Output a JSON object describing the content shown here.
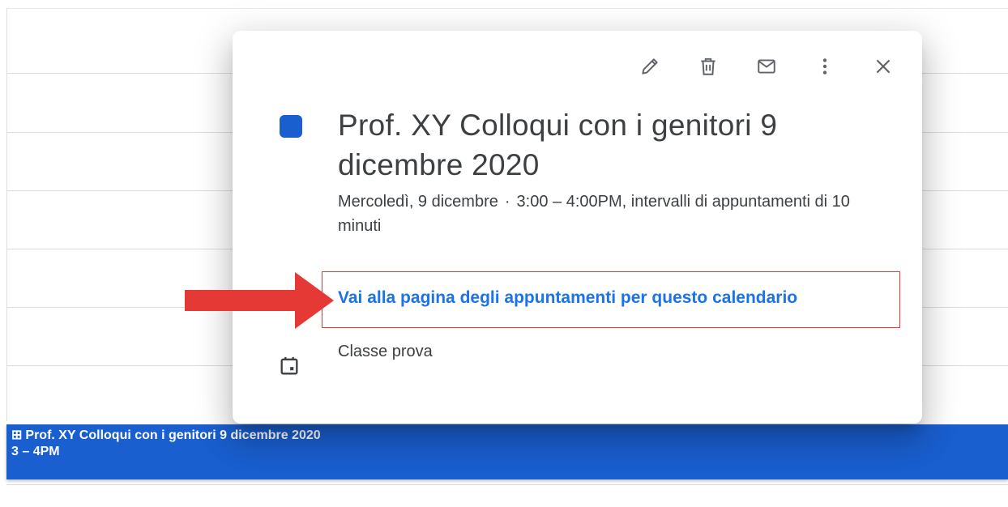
{
  "popup": {
    "toolbar": {
      "edit_icon": "pencil-icon",
      "delete_icon": "trash-icon",
      "email_icon": "mail-icon",
      "more_icon": "more-vert-icon",
      "close_icon": "close-icon"
    },
    "color": "#1a5fd0",
    "title": "Prof. XY Colloqui con i genitori 9 dicembre 2020",
    "date": "Mercoledì, 9 dicembre",
    "separator": "·",
    "time_details": "3:00 – 4:00PM, intervalli di appuntamenti di 10 minuti",
    "appointment_link": "Vai alla pagina degli appuntamenti per questo calendario",
    "calendar_icon": "calendar-icon",
    "calendar_name": "Classe prova"
  },
  "event_bar": {
    "glyph": "⊞",
    "title": "Prof. XY Colloqui con i genitori 9 dicembre 2020",
    "time": "3 – 4PM",
    "color": "#1a5fd0"
  },
  "annotation": {
    "arrow_color": "#e53935",
    "highlight_color": "#e53935"
  }
}
